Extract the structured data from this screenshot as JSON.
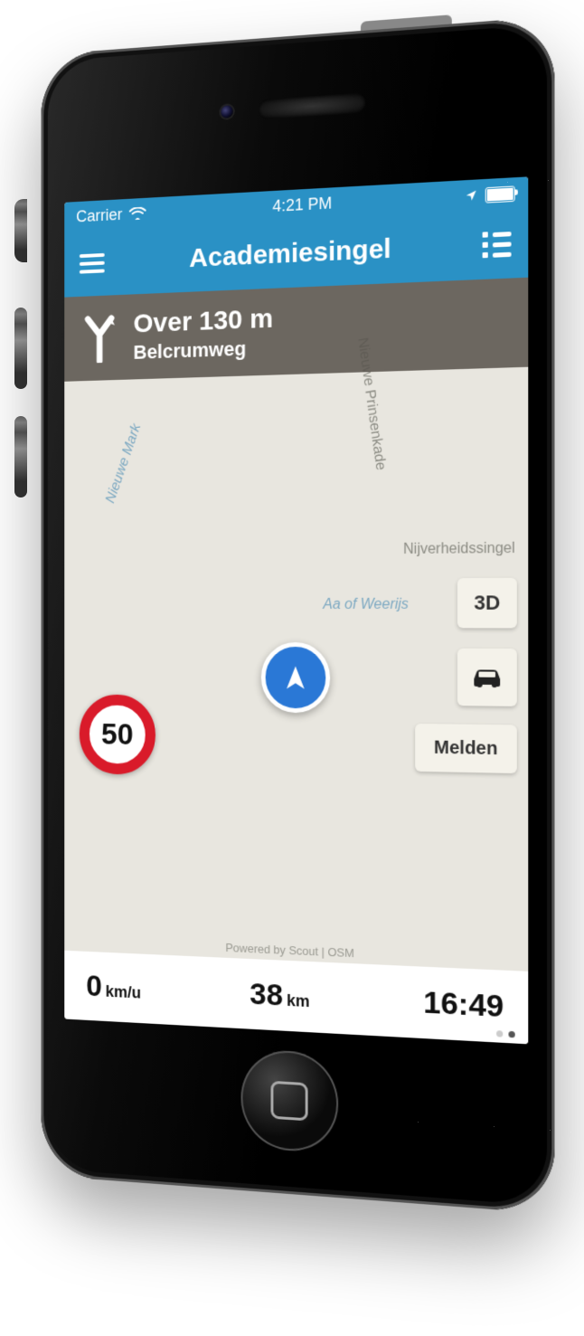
{
  "status": {
    "carrier": "Carrier",
    "time": "4:21 PM"
  },
  "header": {
    "title": "Academiesingel"
  },
  "banner": {
    "distance": "Over 130 m",
    "next_road": "Belcrumweg"
  },
  "map": {
    "labels": {
      "river1": "Nieuwe Mark",
      "road1": "Nieuwe Prinsenkade",
      "road2": "Nijverheidssingel",
      "river2": "Aa of Weerijs",
      "attribution": "Powered by Scout | OSM"
    },
    "buttons": {
      "view3d": "3D",
      "report": "Melden"
    },
    "speed_limit": "50"
  },
  "bottom": {
    "speed_value": "0",
    "speed_unit": "km/u",
    "dist_value": "38",
    "dist_unit": "km",
    "eta": "16:49"
  }
}
